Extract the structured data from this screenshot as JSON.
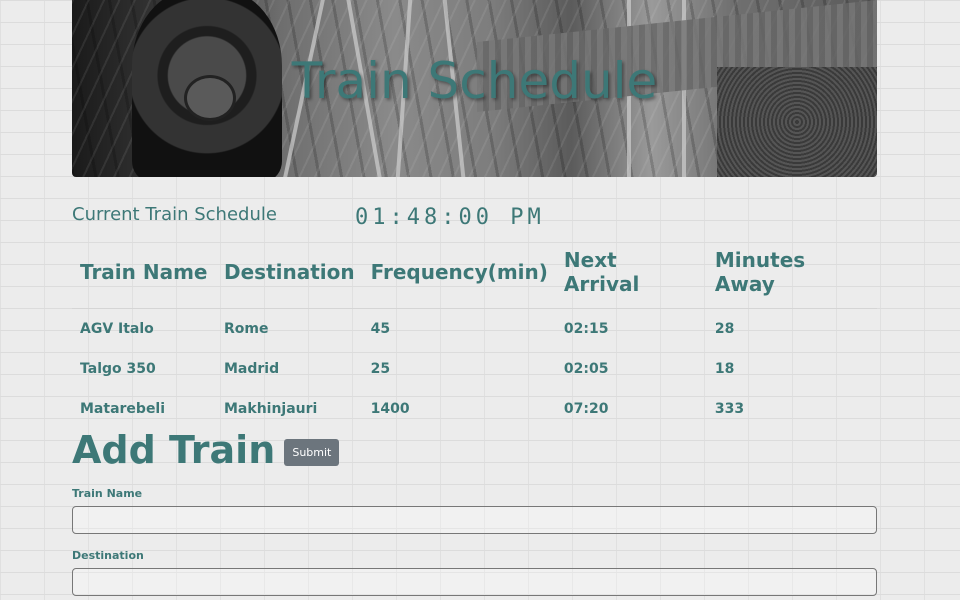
{
  "banner": {
    "title": "Train Schedule"
  },
  "schedule": {
    "title": "Current Train Schedule",
    "clock": "01:48:00 PM",
    "columns": [
      "Train Name",
      "Destination",
      "Frequency(min)",
      "Next Arrival",
      "Minutes Away"
    ],
    "rows": [
      [
        "AGV Italo",
        "Rome",
        "45",
        "02:15",
        "28"
      ],
      [
        "Talgo 350",
        "Madrid",
        "25",
        "02:05",
        "18"
      ],
      [
        "Matarebeli",
        "Makhinjauri",
        "1400",
        "07:20",
        "333"
      ]
    ]
  },
  "add_train": {
    "heading": "Add Train",
    "submit_label": "Submit",
    "fields": [
      {
        "label": "Train Name",
        "value": "",
        "placeholder": ""
      },
      {
        "label": "Destination",
        "value": "",
        "placeholder": ""
      }
    ]
  },
  "colors": {
    "accent": "#3d7877",
    "button": "#6c757d",
    "background": "#ececec"
  }
}
